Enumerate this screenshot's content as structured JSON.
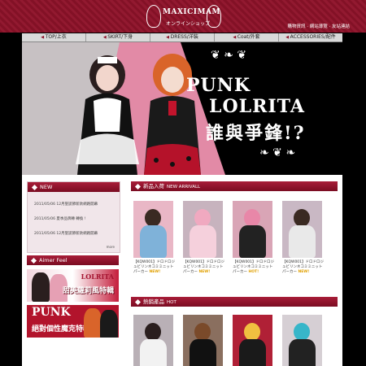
{
  "header": {
    "logo_text": "MAXICIMAM",
    "logo_sub": "オンラインショップ",
    "top_links": "購物資訊 · 網站導覽 · 友站連結"
  },
  "nav": {
    "items": [
      "TOP/上衣",
      "SKIRT/下身",
      "DRESS/洋裝",
      "Coat/外套",
      "ACCESSORIES/配件"
    ]
  },
  "banner": {
    "title_line1": "PUNK",
    "title_line2": "LOLRITA",
    "title_line3": "誰與爭鋒!?"
  },
  "news": {
    "title": "NEW",
    "items": [
      "2011/05/06   12月聖誕節新款網路開幕",
      "2011/05/06   夏季品牌轉 轉換 !",
      "2011/05/06   12月聖誕節新款網路開幕"
    ],
    "more": "more"
  },
  "aimer": {
    "title": "Aimer Feel",
    "ad1_line1": "LOLRITA",
    "ad1_line2": "甜美蘿莉風特輯",
    "ad2_line1": "PUNK",
    "ad2_line2": "絕對個性魔克特輯"
  },
  "new_arrival": {
    "title": "新品入荷",
    "subtitle": "NEW ARRIVALL",
    "products": [
      {
        "caption1": "【KQW001】ドロドロジ",
        "caption2": "ュビリンネコミミニット",
        "caption3": "パーカー",
        "badge": "NEW!"
      },
      {
        "caption1": "【KQW001】ドロドロジ",
        "caption2": "ュビリンネコミミニット",
        "caption3": "パーカー",
        "badge": "NEW!"
      },
      {
        "caption1": "【KQW001】ドロドロジ",
        "caption2": "ュビリンネコミミニット",
        "caption3": "パーカー",
        "badge": "HOT!"
      },
      {
        "caption1": "【KQW001】ドロドロジ",
        "caption2": "ュビリンネコミミニット",
        "caption3": "パーカー",
        "badge": "NEW!"
      }
    ]
  },
  "hot": {
    "title": "熱銷產品",
    "subtitle": "HOT"
  },
  "colors": {
    "brand": "#8e1229",
    "accent": "#a81d38",
    "badge": "#e0a000"
  }
}
